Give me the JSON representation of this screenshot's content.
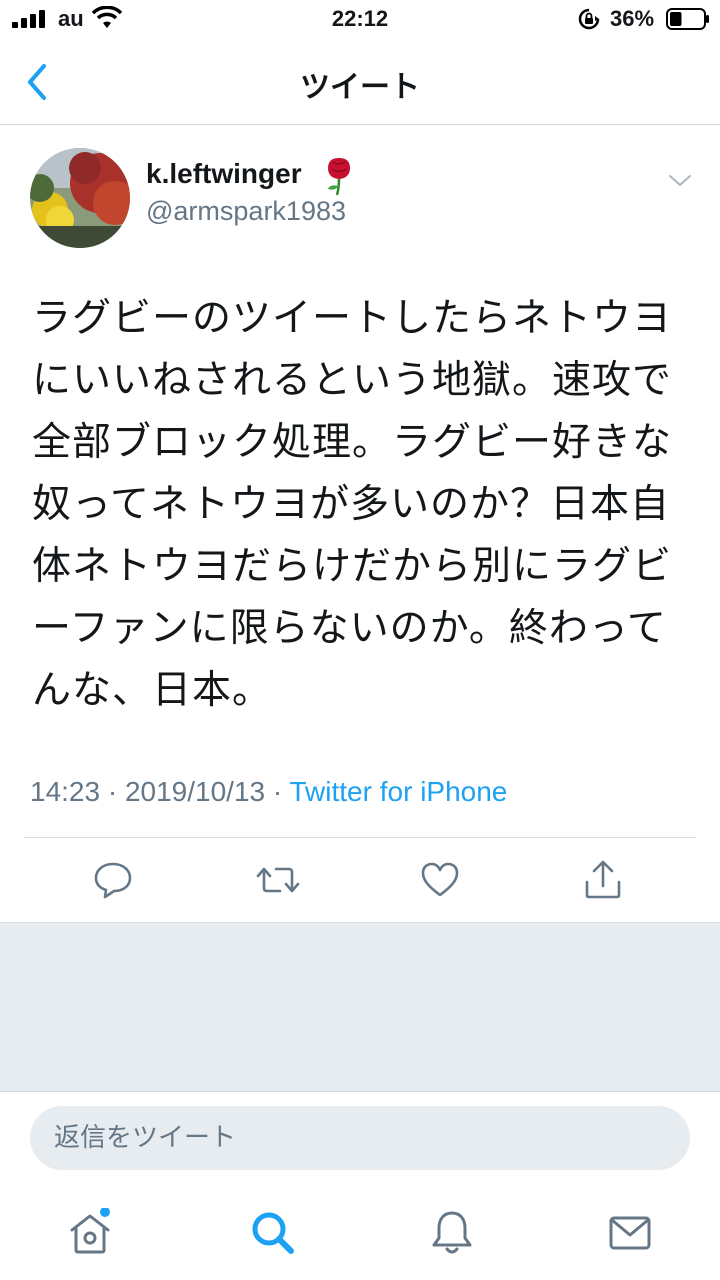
{
  "status_bar": {
    "carrier": "au",
    "time": "22:12",
    "battery_percent": "36%",
    "battery_level": 0.36
  },
  "nav": {
    "title": "ツイート",
    "back_icon": "chevron-left-icon"
  },
  "tweet": {
    "display_name": "k.leftwinger",
    "name_emoji": "rose-icon",
    "handle": "@armspark1983",
    "text": "ラグビーのツイートしたらネトウヨ\nにいいねされるという地獄。速攻で\n全部ブロック処理。ラグビー好きな\n奴ってネトウヨが多いのか？日本自\n体ネトウヨだらけだから別にラグビ\nーファンに限らないのか。終わって\nんな、日本。",
    "time": "14:23",
    "date": "2019/10/13",
    "separator": " · ",
    "source": "Twitter for iPhone"
  },
  "actions": [
    "reply-icon",
    "retweet-icon",
    "like-icon",
    "share-icon"
  ],
  "reply": {
    "placeholder": "返信をツイート"
  },
  "tab_bar": [
    "home-icon",
    "search-icon",
    "notifications-icon",
    "messages-icon"
  ],
  "colors": {
    "accent": "#1da1f2",
    "secondary_text": "#657786",
    "background_gray": "#e6ecf0",
    "icon_gray": "#657786"
  }
}
